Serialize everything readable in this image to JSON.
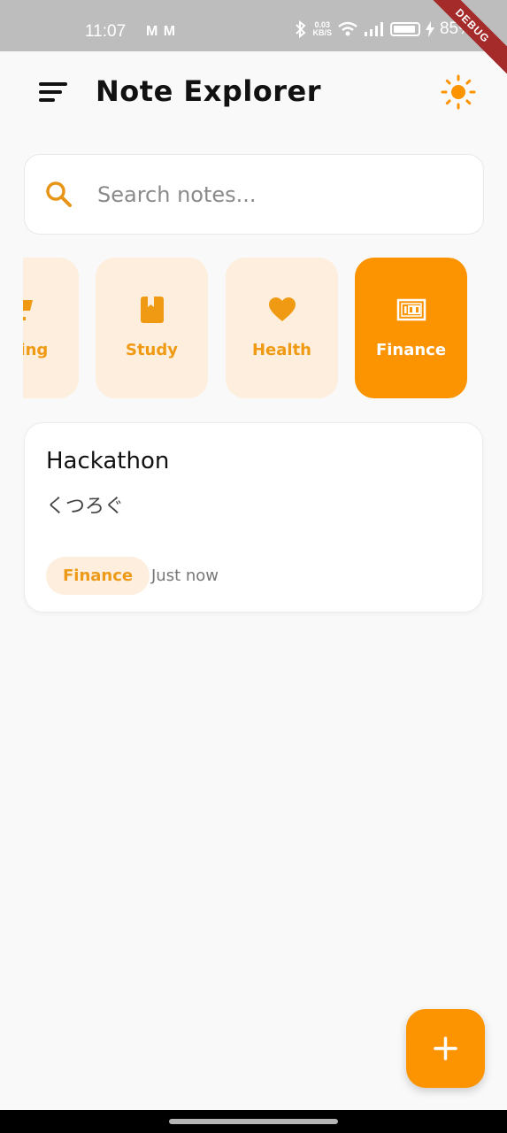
{
  "status_bar": {
    "time": "11:07",
    "notification_icons": "M M",
    "net_speed_value": "0.03",
    "net_speed_unit": "KB/S",
    "battery": "85%",
    "debug_label": "DEBUG"
  },
  "app_bar": {
    "title": "Note Explorer",
    "menu_icon": "sort-menu-icon",
    "theme_icon": "sun-icon"
  },
  "search": {
    "placeholder": "Search notes...",
    "value": ""
  },
  "categories": [
    {
      "label": "Shopping",
      "visible_label": "pping",
      "icon": "shopping-cart-icon",
      "active": false
    },
    {
      "label": "Study",
      "icon": "book-icon",
      "active": false
    },
    {
      "label": "Health",
      "icon": "heart-icon",
      "active": false
    },
    {
      "label": "Finance",
      "icon": "money-icon",
      "active": true
    }
  ],
  "notes": [
    {
      "title": "Hackathon",
      "body": "くつろぐ",
      "tag": "Finance",
      "time": "Just now"
    }
  ],
  "fab": {
    "icon": "plus-icon"
  },
  "colors": {
    "accent": "#fb9400",
    "accent_light": "#fdeedd",
    "background": "#f9f9f9",
    "status_bar": "#bdbdbd"
  }
}
